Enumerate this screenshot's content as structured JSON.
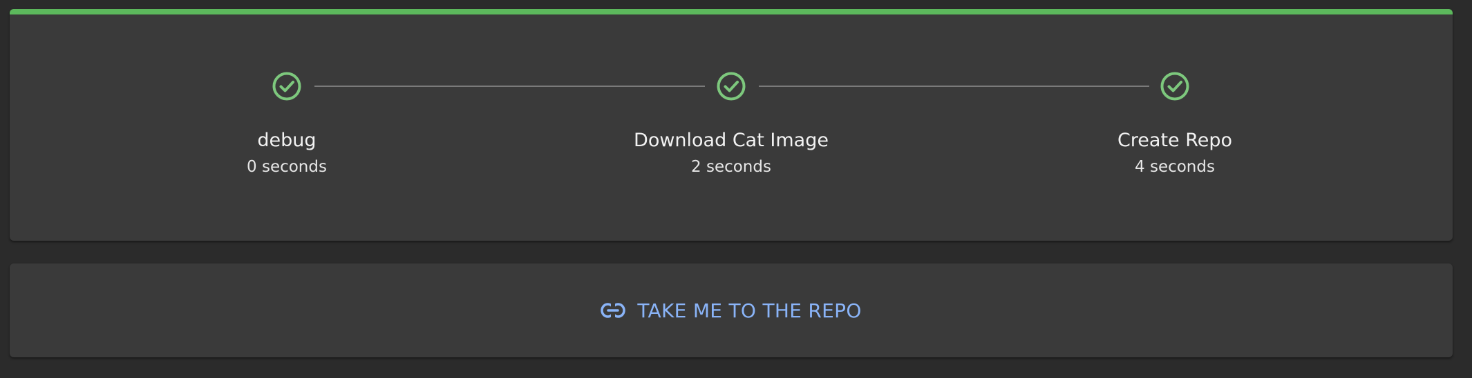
{
  "colors": {
    "success": "#5cb85c",
    "check": "#7dc87d",
    "link": "#8ab4f8"
  },
  "steps": [
    {
      "title": "debug",
      "duration": "0 seconds",
      "status": "complete",
      "icon": "check-circle-icon"
    },
    {
      "title": "Download Cat Image",
      "duration": "2 seconds",
      "status": "complete",
      "icon": "check-circle-icon"
    },
    {
      "title": "Create Repo",
      "duration": "4 seconds",
      "status": "complete",
      "icon": "check-circle-icon"
    }
  ],
  "repo_link": {
    "label": "TAKE ME TO THE REPO",
    "icon": "link-icon"
  }
}
